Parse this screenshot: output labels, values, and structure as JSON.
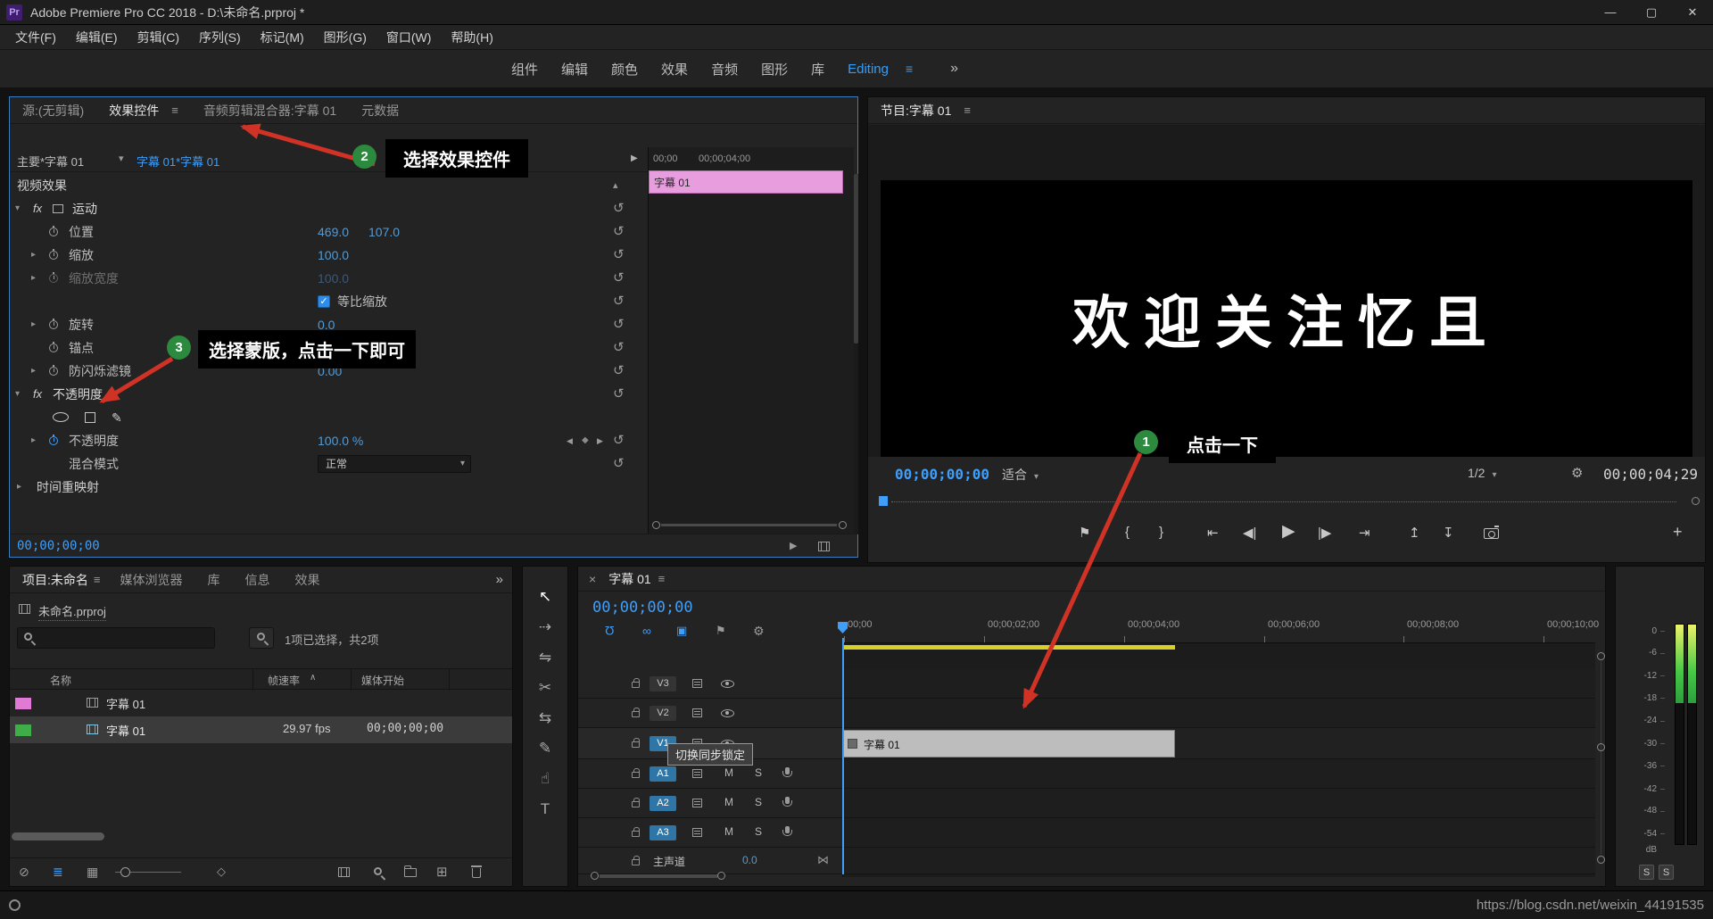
{
  "title_bar": {
    "title": "Adobe Premiere Pro CC 2018 - D:\\未命名.prproj *"
  },
  "menu_bar": [
    "文件(F)",
    "编辑(E)",
    "剪辑(C)",
    "序列(S)",
    "标记(M)",
    "图形(G)",
    "窗口(W)",
    "帮助(H)"
  ],
  "workspace_bar": {
    "tabs": [
      "组件",
      "编辑",
      "颜色",
      "效果",
      "音频",
      "图形",
      "库",
      "Editing"
    ],
    "active": "Editing"
  },
  "effect_controls": {
    "tabs": [
      "源:(无剪辑)",
      "效果控件",
      "音频剪辑混合器:字幕 01",
      "元数据"
    ],
    "active_tab": "效果控件",
    "master_clip": "主要*字幕 01",
    "sequence_clip": "字幕 01*字幕 01",
    "ruler": [
      "00;00",
      "00;00;04;00"
    ],
    "mini_clip": "字幕 01",
    "rows": [
      {
        "label": "视频效果"
      },
      {
        "label": "运动",
        "fx": "fx"
      },
      {
        "label": "位置",
        "values": [
          "469.0",
          "107.0"
        ]
      },
      {
        "label": "缩放",
        "values": [
          "100.0"
        ]
      },
      {
        "label": "缩放宽度",
        "values": [
          "100.0"
        ]
      },
      {
        "label": "等比缩放"
      },
      {
        "label": "旋转",
        "values": [
          "0.0"
        ]
      },
      {
        "label": "锚点"
      },
      {
        "label": "防闪烁滤镜",
        "values": [
          "0.00"
        ]
      },
      {
        "label": "不透明度",
        "fx": "fx"
      },
      {
        "label": ""
      },
      {
        "label": "不透明度",
        "values": [
          "100.0 %"
        ]
      },
      {
        "label": "混合模式",
        "dropdown": "正常"
      },
      {
        "label": "时间重映射"
      }
    ],
    "footer_timecode": "00;00;00;00"
  },
  "program_monitor": {
    "tab": "节目:字幕 01",
    "frame_text": "欢迎关注忆且",
    "timecode": "00;00;00;00",
    "fit": "适合",
    "zoom_level": "1/2",
    "duration": "00;00;04;29"
  },
  "project_panel": {
    "tabs": [
      "项目:未命名",
      "媒体浏览器",
      "库",
      "信息",
      "效果"
    ],
    "overflow": "»",
    "file_name": "未命名.prproj",
    "selection_status": "1项已选择，共2项",
    "columns": [
      "名称",
      "帧速率",
      "媒体开始"
    ],
    "rows": [
      {
        "name": "字幕 01",
        "frame_rate": "",
        "media_start": "",
        "label_color": "#e07ad4",
        "selected": false
      },
      {
        "name": "字幕 01",
        "frame_rate": "29.97 fps",
        "media_start": "00;00;00;00",
        "label_color": "#3fae49",
        "selected": true
      }
    ]
  },
  "timeline": {
    "close_label": "×",
    "tab": "字幕 01",
    "timecode": "00;00;00;00",
    "ruler_ticks": [
      "00;00",
      "00;00;02;00",
      "00;00;04;00",
      "00;00;06;00",
      "00;00;08;00",
      "00;00;10;00"
    ],
    "video_tracks": [
      "V3",
      "V2",
      "V1"
    ],
    "audio_tracks": [
      "A1",
      "A2",
      "A3"
    ],
    "targeted_tracks": [
      "V1",
      "A1",
      "A2",
      "A3"
    ],
    "mute_label": "M",
    "solo_label": "S",
    "master_label": "主声道",
    "master_value": "0.0",
    "clip_label": "字幕 01",
    "tooltip": "切换同步锁定"
  },
  "audio_meter": {
    "scale": [
      "0",
      "-6",
      "-12",
      "-18",
      "-24",
      "-30",
      "-36",
      "-42",
      "-48",
      "-54"
    ],
    "unit": "dB",
    "solo": "S"
  },
  "status_bar": {
    "watermark": "https://blog.csdn.net/weixin_44191535"
  },
  "annotations": {
    "step1": "1",
    "step1_label": "点击一下",
    "step2": "2",
    "step2_label": "选择效果控件",
    "step3": "3",
    "step3_label": "选择蒙版，点击一下即可"
  },
  "colors": {
    "accent_blue": "#2d8ceb",
    "timecode_blue": "#3f9efa",
    "value_blue": "#549bd5",
    "clip_pink": "#e79dde",
    "chip_pink": "#e07ad4",
    "chip_green": "#3fae49",
    "workarea_yellow": "#d8cf2a",
    "annotation_red": "#d03325",
    "annotation_green": "#2b8a3e",
    "track_target_blue": "#2f76a6",
    "timeline_clip_gray": "#bdbdbd"
  },
  "icons": {
    "app_badge": "Pr",
    "hamburger": "≡",
    "overflow": "»",
    "minimize": "—",
    "maximize": "▢",
    "close": "✕",
    "chevron_down": "▾",
    "chevron_right": "▸",
    "chevron_up": "▴",
    "reset": "↺",
    "check": "✓",
    "pen": "✎",
    "play": "▶",
    "step_back": "◀|",
    "step_fwd": "|▶",
    "goto_in": "⇤",
    "goto_out": "⇥",
    "mark_in": "{",
    "mark_out": "}",
    "marker": "⚑",
    "lift": "↥",
    "extract": "↧",
    "plus": "+",
    "magnet": "Ω",
    "link": "∞",
    "nest": "▣",
    "gear": "⚙",
    "sort_asc": "∧",
    "bowtie": "⋈",
    "kf_prev": "◀",
    "kf_diamond": "◆",
    "kf_next": "▶",
    "readonly": "⊘",
    "list_view": "≣",
    "grid_view": "▦",
    "new_item": "⊞",
    "diamond": "◇",
    "tool_select": "↖",
    "tool_track": "⇢",
    "tool_ripple": "⇋",
    "tool_razor": "✂",
    "tool_slip": "⇆",
    "tool_pen": "✎",
    "tool_hand": "☝",
    "tool_type": "T"
  }
}
